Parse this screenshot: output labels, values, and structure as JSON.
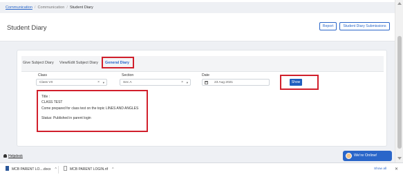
{
  "breadcrumb": {
    "root": "Communication",
    "parent": "Communication",
    "current": "Student Diary"
  },
  "header": {
    "title": "Student Diary",
    "report_button": "Report",
    "submissions_button": "Student Diary Submissions"
  },
  "tabs": [
    {
      "label": "Give Subject Diary",
      "active": false
    },
    {
      "label": "View/Edit Subject Diary",
      "active": false
    },
    {
      "label": "General Diary",
      "active": true
    }
  ],
  "filters": {
    "class_label": "Class",
    "class_value": "Class VII",
    "section_label": "Section",
    "section_value": "Sec A",
    "date_label": "Date",
    "date_value": "23 Aug 2021",
    "show_button": "Show"
  },
  "diary": {
    "title_label": "Title :",
    "title": "CLASS TEST",
    "body": "Come prepared for class test on the topic LINES AND ANGLES",
    "status": "Status: Published in parent login"
  },
  "helpdesk": "Helpdesk",
  "chat": {
    "label": "We're Online!"
  },
  "downloads": {
    "items": [
      {
        "name": "MCB PARENT LO....docx"
      },
      {
        "name": "MCB PARENT LOGIN.rtf"
      }
    ],
    "show_all": "Show all",
    "close": "✕"
  },
  "colors": {
    "accent": "#2a66c9",
    "highlight": "#d11f2b",
    "chat": "#2a66c9"
  }
}
